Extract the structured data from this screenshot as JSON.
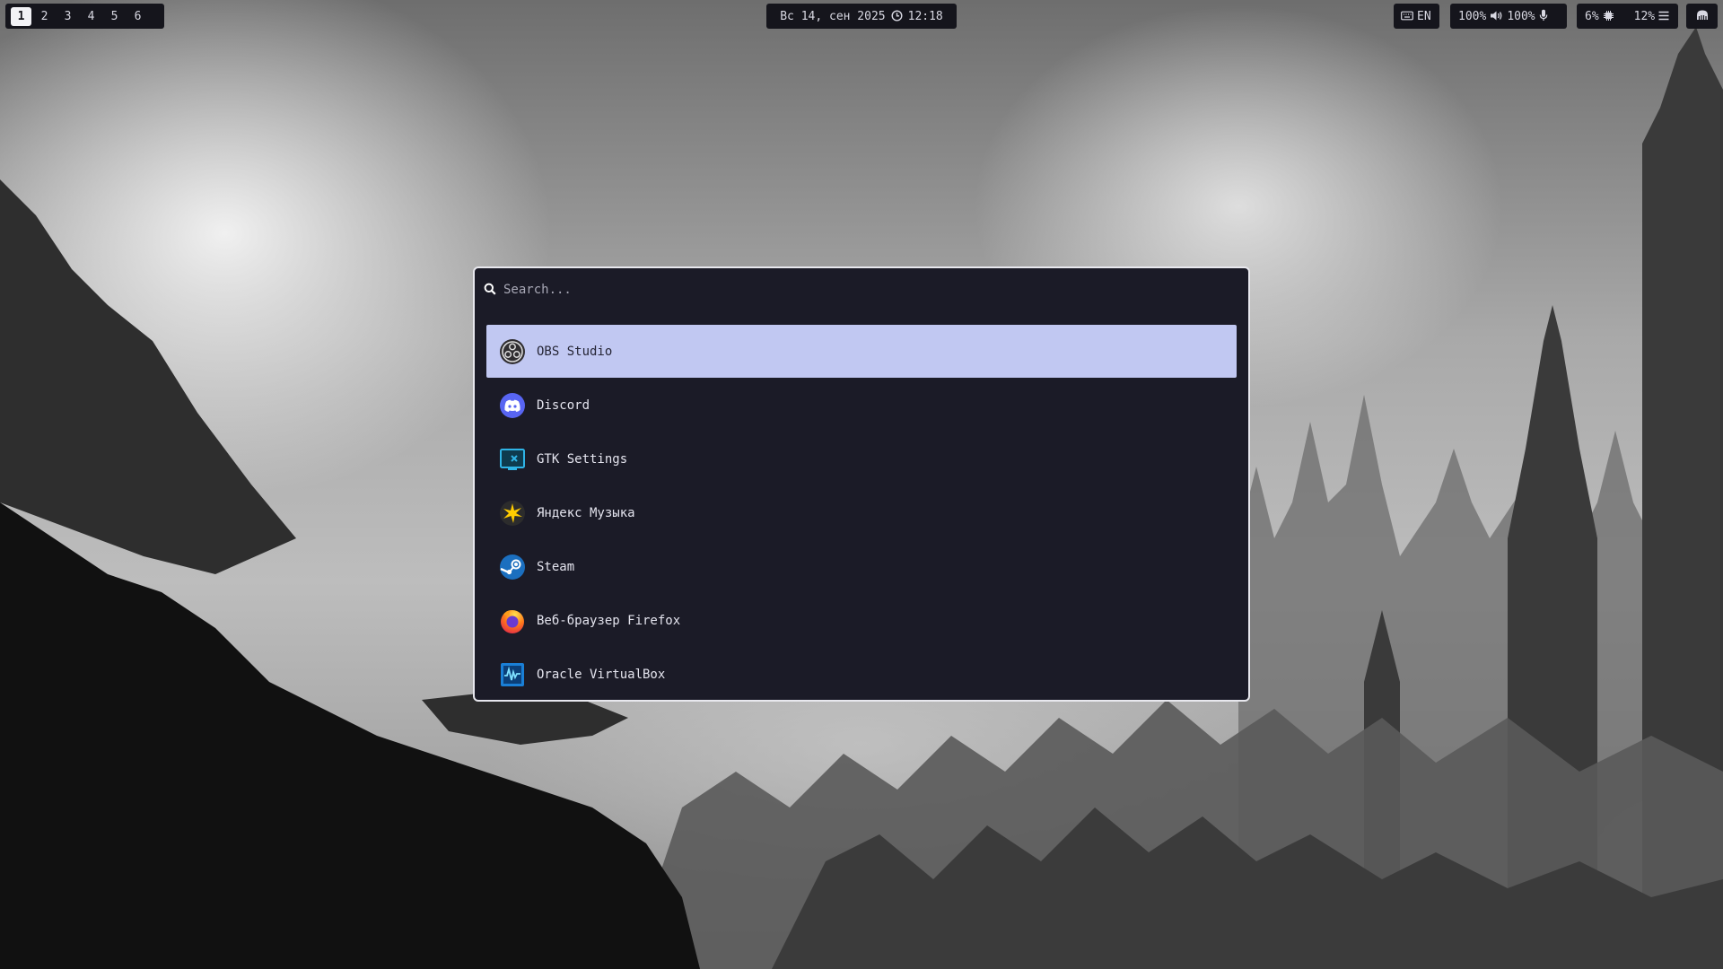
{
  "topbar": {
    "workspaces": [
      "1",
      "2",
      "3",
      "4",
      "5",
      "6"
    ],
    "active_workspace": "1",
    "datetime": {
      "date": "Вс 14, сен 2025",
      "time": "12:18",
      "icon": "clock-icon"
    },
    "keyboard": {
      "icon": "keyboard-icon",
      "layout": "EN"
    },
    "audio": {
      "volume": "100%",
      "volume_icon": "speaker-icon",
      "mic": "100%",
      "mic_icon": "microphone-icon"
    },
    "system": {
      "cpu": "6%",
      "cpu_icon": "chip-icon",
      "memory": "12%",
      "memory_icon": "menu-lines-icon"
    },
    "tray_icon": "tray-app-icon"
  },
  "launcher": {
    "search": {
      "placeholder": "Search...",
      "value": "",
      "icon": "search-icon"
    },
    "selected_index": 0,
    "apps": [
      {
        "label": "OBS Studio",
        "icon": "obs-icon"
      },
      {
        "label": "Discord",
        "icon": "discord-icon"
      },
      {
        "label": "GTK Settings",
        "icon": "gtk-settings-icon"
      },
      {
        "label": "Яндекс Музыка",
        "icon": "yandex-music-icon"
      },
      {
        "label": "Steam",
        "icon": "steam-icon"
      },
      {
        "label": "Веб-браузер Firefox",
        "icon": "firefox-icon"
      },
      {
        "label": "Oracle VirtualBox",
        "icon": "virtualbox-icon"
      }
    ]
  },
  "colors": {
    "bar_bg": "#15151c",
    "launcher_bg": "#1b1b27",
    "selection": "#c1c8f2",
    "border": "#e8e8ee"
  }
}
